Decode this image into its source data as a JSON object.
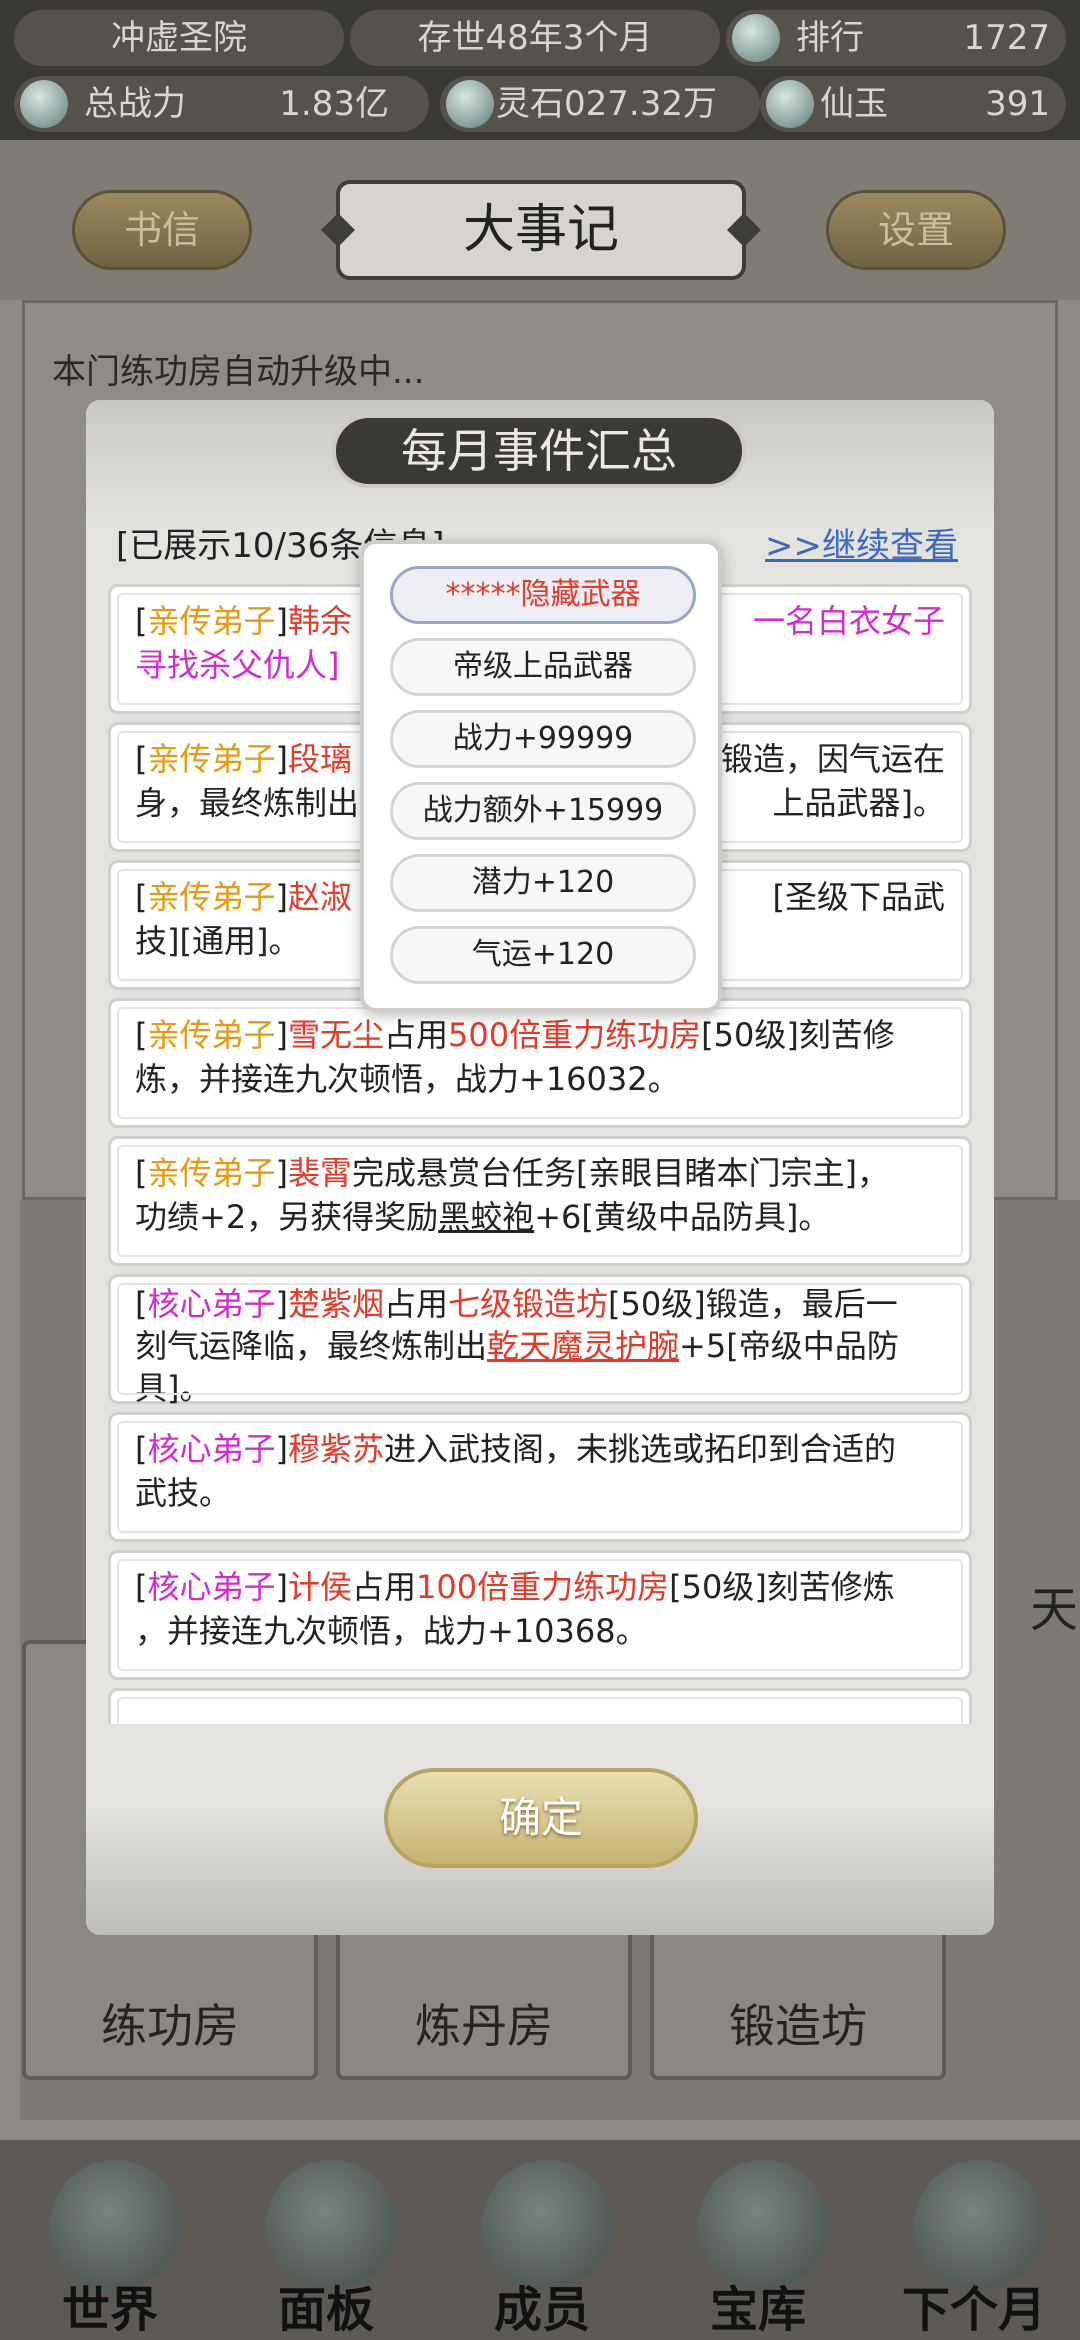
{
  "topbar": {
    "sect_name": "冲虚圣院",
    "time": "存世48年3个月",
    "rank_label": "排行",
    "rank_value": "1727",
    "power_label": "总战力",
    "power_value": "1.83亿",
    "stone_label": "灵石027.32万",
    "jade_label": "仙玉",
    "jade_value": "391"
  },
  "header": {
    "letter_button": "书信",
    "title": "大事记",
    "settings_button": "设置"
  },
  "background": {
    "first_line": "本门练功房自动升级中...",
    "cards": [
      "练功房",
      "炼丹房",
      "锻造坊"
    ],
    "side_char": "天",
    "nav": [
      "世界",
      "面板",
      "成员",
      "宝库",
      "下个月"
    ]
  },
  "modal": {
    "title": "每月事件汇总",
    "count_text": "[已展示10/36条信息]",
    "more_link": ">>继续查看",
    "confirm": "确定"
  },
  "events": [
    {
      "b1": "[",
      "role": "亲传弟子",
      "b2": "]",
      "name": "韩余",
      "t1": "",
      "t2": "一名白衣女子",
      "t3": "寻找杀父仇人]"
    },
    {
      "b1": "[",
      "role": "亲传弟子",
      "b2": "]",
      "name": "段璃",
      "t1": "锻造，因气运在",
      "t2": "身，最终炼制出",
      "t3": "上品武器]。"
    },
    {
      "b1": "[",
      "role": "亲传弟子",
      "b2": "]",
      "name": "赵淑",
      "t1": "[圣级下品武",
      "t2": "技][通用]。"
    },
    {
      "b1": "[",
      "role": "亲传弟子",
      "b2": "]",
      "name": "雪无尘",
      "t1": "占用",
      "room": "500倍重力练功房",
      "t2": "[50级]刻苦修",
      "t3": "炼，并接连九次顿悟，战力+16032。"
    },
    {
      "b1": "[",
      "role": "亲传弟子",
      "b2": "]",
      "name": "裴霄",
      "t1": "完成悬赏台任务[亲眼目睹本门宗主]，",
      "t2": "功绩+2，另获得奖励",
      "item": "黑蛟袍",
      "t3": "+6[黄级中品防具]。"
    },
    {
      "b1": "[",
      "role": "核心弟子",
      "b2": "]",
      "name": "楚紫烟",
      "t1": "占用",
      "room": "七级锻造坊",
      "t2": "[50级]锻造，最后一",
      "t3": "刻气运降临，最终炼制出",
      "item": "乾天魔灵护腕",
      "t4": "+5[帝级中品防",
      "t5": "具]。"
    },
    {
      "b1": "[",
      "role": "核心弟子",
      "b2": "]",
      "name": "穆紫苏",
      "t1": "进入武技阁，未挑选或拓印到合适的",
      "t2": "武技。"
    },
    {
      "b1": "[",
      "role": "核心弟子",
      "b2": "]",
      "name": "计侯",
      "t1": "占用",
      "room": "100倍重力练功房",
      "t2": "[50级]刻苦修炼",
      "t3": "，并接连九次顿悟，战力+10368。"
    }
  ],
  "popup": {
    "weapon_name": "*****隐藏武器",
    "grade": "帝级上品武器",
    "power": "战力+99999",
    "extra_power": "战力额外+15999",
    "potential": "潜力+120",
    "luck": "气运+120"
  }
}
